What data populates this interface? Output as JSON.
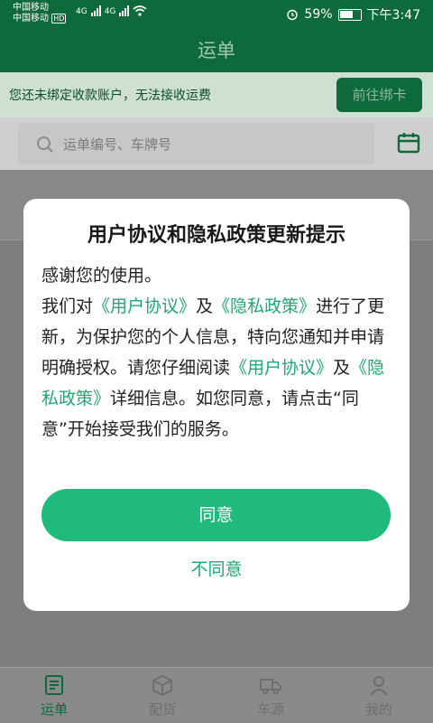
{
  "status_bar": {
    "carrier1": "中国移动",
    "carrier2": "中国移动",
    "hd": "HD",
    "network1": "4G",
    "network2": "4G",
    "battery": "59%",
    "time": "下午3:47"
  },
  "header": {
    "title": "运单"
  },
  "bind_banner": {
    "text": "您还未绑定收款账户，无法接收运费",
    "button": "前往绑卡"
  },
  "search": {
    "placeholder": "运单编号、车牌号"
  },
  "dialog": {
    "title": "用户协议和隐私政策更新提示",
    "line1": "感谢您的使用。",
    "p1": "我们对",
    "link_user": "《用户协议》",
    "and": "及",
    "link_privacy": "《隐私政策》",
    "p2": "进行了更新，为保护您的个人信息，特向您通知并申请明确授权。请您仔细阅读",
    "p3": "详细信息。如您同意，请点击“同意”开始接受我们的服务。",
    "agree": "同意",
    "disagree": "不同意"
  },
  "tabs": [
    {
      "label": "运单",
      "icon": "waybill-icon",
      "active": true
    },
    {
      "label": "配货",
      "icon": "package-icon",
      "active": false
    },
    {
      "label": "车源",
      "icon": "truck-icon",
      "active": false
    },
    {
      "label": "我的",
      "icon": "person-icon",
      "active": false
    }
  ],
  "colors": {
    "brand": "#0e6a3a",
    "accent": "#1fba7c",
    "link": "#1ea873"
  }
}
